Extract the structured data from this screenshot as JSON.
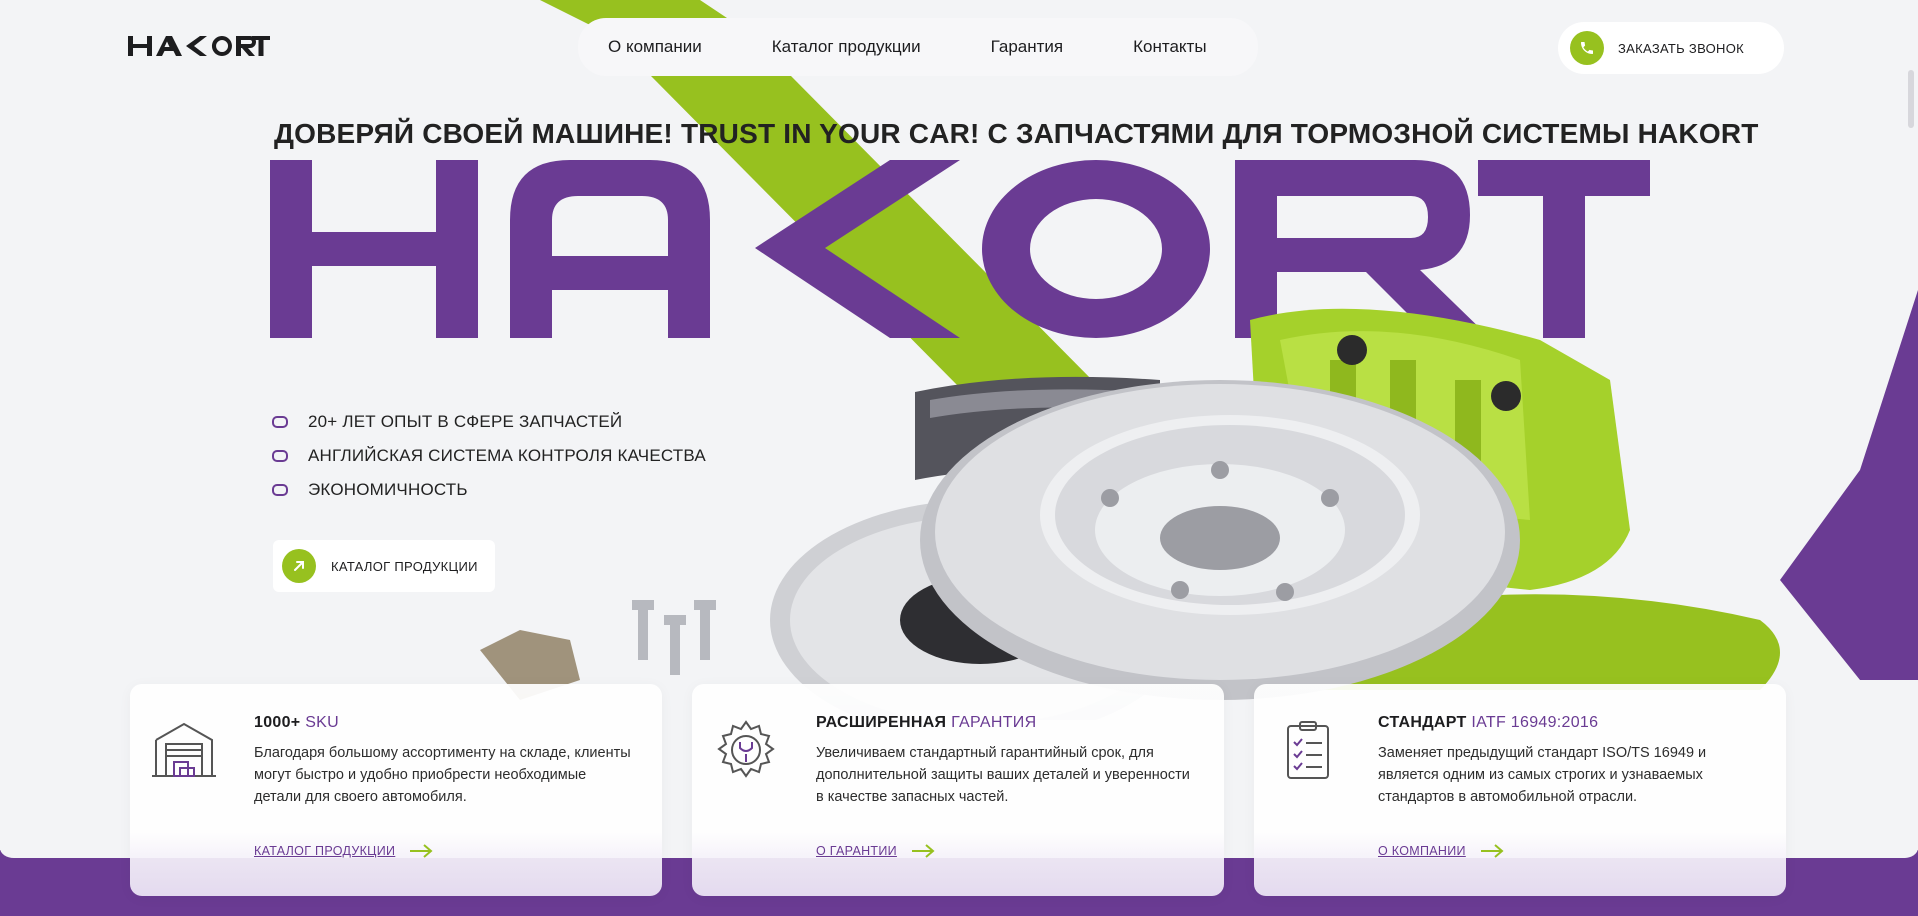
{
  "header": {
    "logo_text": "HAKORT",
    "nav": [
      "О компании",
      "Каталог продукции",
      "Гарантия",
      "Контакты"
    ],
    "call_button": "ЗАКАЗАТЬ ЗВОНОК"
  },
  "hero": {
    "tagline": "ДОВЕРЯЙ СВОЕЙ МАШИНЕ! TRUST IN YOUR CAR! С ЗАПЧАСТЯМИ ДЛЯ ТОРМОЗНОЙ СИСТЕМЫ HAKORT",
    "big_word": "HAKORT",
    "features": [
      "20+ ЛЕТ ОПЫТ В СФЕРЕ ЗАПЧАСТЕЙ",
      "АНГЛИЙСКАЯ СИСТЕМА КОНТРОЛЯ КАЧЕСТВА",
      "ЭКОНОМИЧНОСТЬ"
    ],
    "catalog_button": "КАТАЛОГ ПРОДУКЦИИ"
  },
  "cards": [
    {
      "title_main": "1000+",
      "title_accent": "SKU",
      "description": "Благодаря большому ассортименту на складе, клиенты могут быстро и удобно приобрести необходимые детали для своего автомобиля.",
      "link": "КАТАЛОГ ПРОДУКЦИИ",
      "icon": "warehouse-icon"
    },
    {
      "title_main": "РАСШИРЕННАЯ",
      "title_accent": "ГАРАНТИЯ",
      "description": "Увеличиваем стандартный гарантийный срок, для дополнительной защиты ваших деталей и уверенности в качестве запасных частей.",
      "link": "О ГАРАНТИИ",
      "icon": "gear-wrench-icon"
    },
    {
      "title_main": "СТАНДАРТ",
      "title_accent": "IATF 16949:2016",
      "description": "Заменяет предыдущий стандарт ISO/TS 16949 и является одним из самых строгих и узнаваемых стандартов в автомобильной отрасли.",
      "link": "О КОМПАНИИ",
      "icon": "checklist-icon"
    }
  ],
  "colors": {
    "brand_purple": "#6a3b93",
    "accent_green": "#97c11f",
    "background": "#f3f4f6"
  }
}
